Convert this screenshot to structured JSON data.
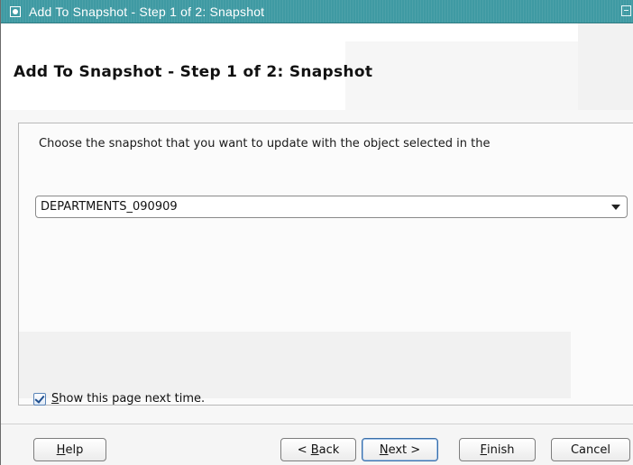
{
  "window": {
    "title": "Add To Snapshot - Step 1 of 2: Snapshot",
    "icon": "window-menu-icon",
    "restore_icon": "restore-icon"
  },
  "header": {
    "title": "Add To Snapshot - Step 1 of 2: Snapshot"
  },
  "main": {
    "instruction": "Choose the snapshot that you want to update with the object selected in the",
    "snapshot_select": {
      "value": "DEPARTMENTS_090909"
    },
    "show_page_checkbox": {
      "checked": true,
      "mnemonic": "S",
      "label_rest": "how this page next time."
    }
  },
  "buttons": {
    "help": {
      "mnemonic": "H",
      "rest": "elp"
    },
    "back": {
      "prefix": "< ",
      "mnemonic": "B",
      "rest": "ack"
    },
    "next": {
      "mnemonic": "N",
      "rest": "ext >"
    },
    "finish": {
      "mnemonic": "F",
      "rest": "inish"
    },
    "cancel": {
      "label": "Cancel"
    }
  },
  "colors": {
    "titlebar": "#3f9aa3",
    "default_button_border": "#3a6ea8"
  }
}
